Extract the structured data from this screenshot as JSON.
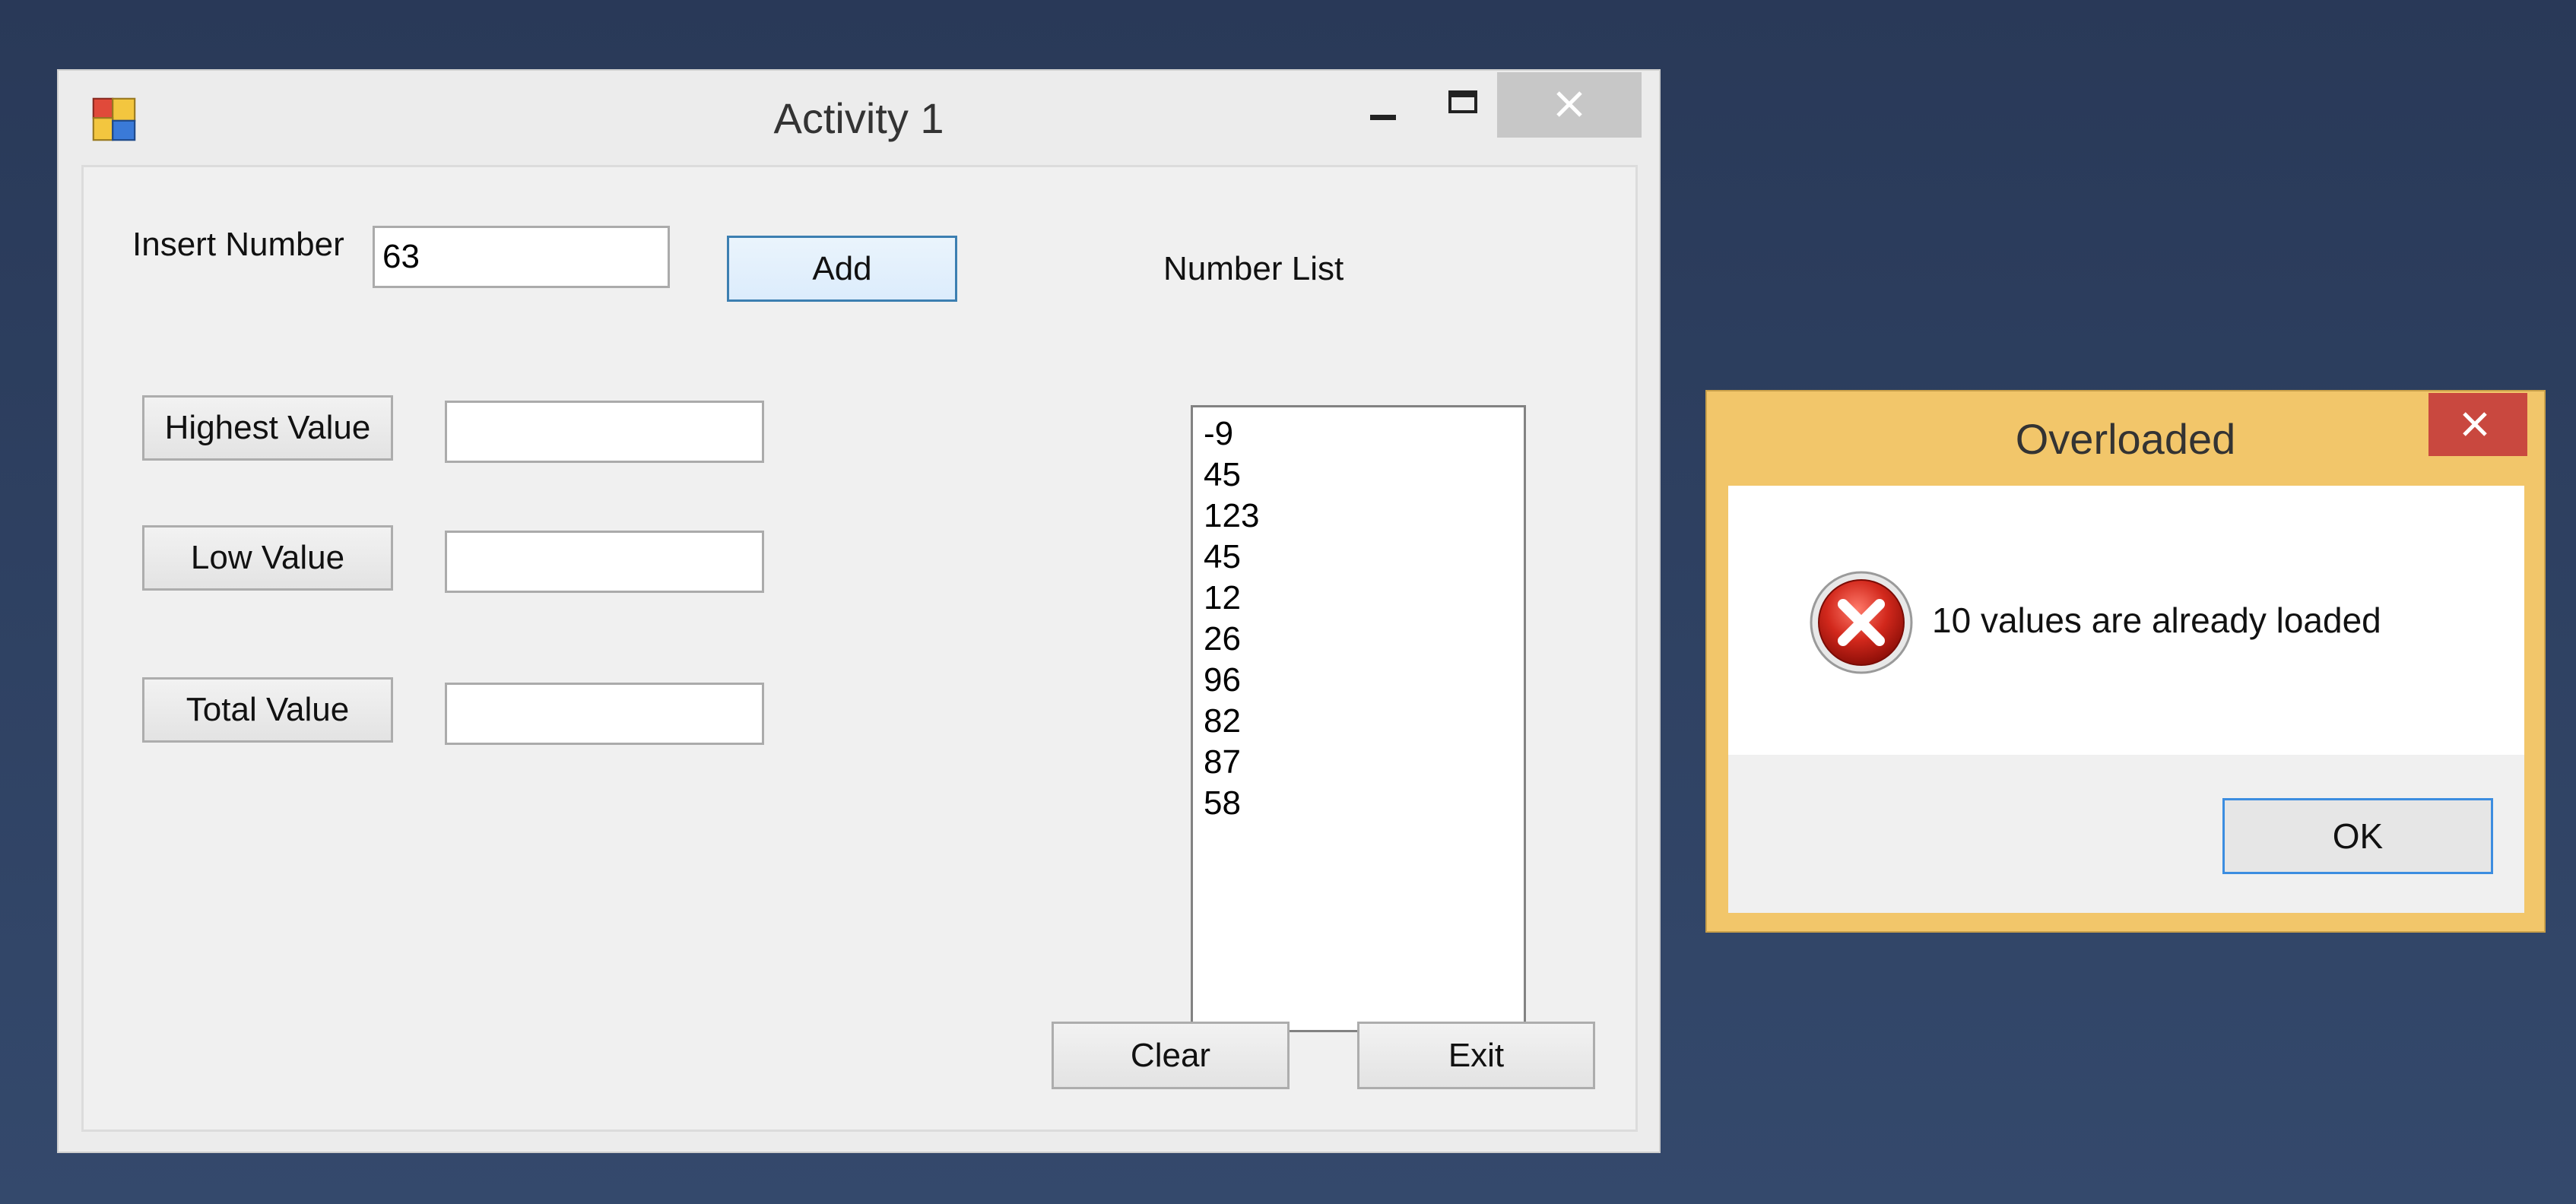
{
  "main_window": {
    "title": "Activity 1",
    "insert_number_label": "Insert Number",
    "insert_number_value": "63",
    "add_label": "Add",
    "number_list_label": "Number List",
    "highest_value_label": "Highest Value",
    "highest_value_text": "",
    "low_value_label": "Low Value",
    "low_value_text": "",
    "total_value_label": "Total Value",
    "total_value_text": "",
    "number_list": [
      "-9",
      "45",
      "123",
      "45",
      "12",
      "26",
      "96",
      "82",
      "87",
      "58"
    ],
    "clear_label": "Clear",
    "exit_label": "Exit"
  },
  "dialog": {
    "title": "Overloaded",
    "message": "10 values are already loaded",
    "ok_label": "OK",
    "icon": "error-icon"
  },
  "colors": {
    "desktop": "#2e4163",
    "dialog_frame": "#f2c66a",
    "close_button_red": "#c9483f",
    "default_button_border": "#3c8de0"
  }
}
